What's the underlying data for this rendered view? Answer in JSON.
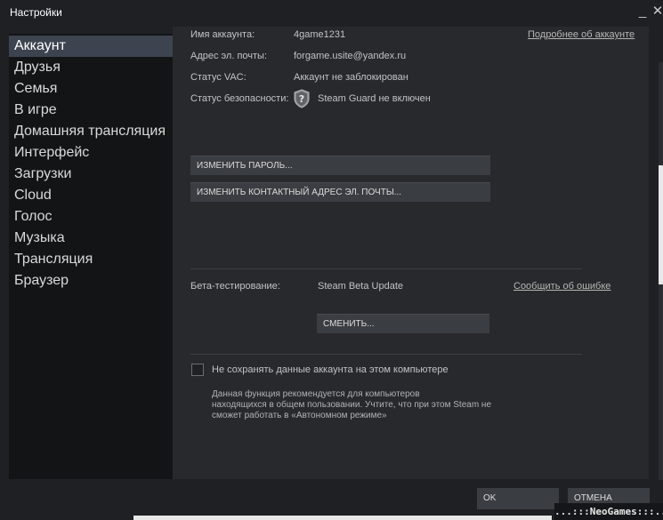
{
  "window": {
    "title": "Настройки",
    "minimize_glyph": "_",
    "close_glyph": "✕"
  },
  "sidebar": {
    "items": [
      {
        "label": "Аккаунт",
        "active": true
      },
      {
        "label": "Друзья"
      },
      {
        "label": "Семья"
      },
      {
        "label": "В игре"
      },
      {
        "label": "Домашняя трансляция"
      },
      {
        "label": "Интерфейс"
      },
      {
        "label": "Загрузки"
      },
      {
        "label": "Cloud"
      },
      {
        "label": "Голос"
      },
      {
        "label": "Музыка"
      },
      {
        "label": "Трансляция"
      },
      {
        "label": "Браузер"
      }
    ]
  },
  "account": {
    "name_label": "Имя аккаунта:",
    "name_value": "4game1231",
    "details_link": "Подробнее об аккаунте",
    "email_label": "Адрес эл. почты:",
    "email_value": "forgame.usite@yandex.ru",
    "vac_label": "Статус VAC:",
    "vac_value": "Аккаунт не заблокирован",
    "security_label": "Статус безопасности:",
    "security_value": "Steam Guard не включен",
    "security_icon": "steam-guard-shield-icon",
    "change_password_button": "ИЗМЕНИТЬ ПАРОЛЬ...",
    "change_email_button": "ИЗМЕНИТЬ КОНТАКТНЫЙ АДРЕС ЭЛ. ПОЧТЫ..."
  },
  "beta": {
    "label": "Бета-тестирование:",
    "value": "Steam Beta Update",
    "report_link": "Сообщить об ошибке",
    "change_button": "СМЕНИТЬ..."
  },
  "remember": {
    "checkbox_label": "Не сохранять данные аккаунта на этом компьютере",
    "checked": false,
    "note_lines": [
      "Данная функция рекомендуется для компьютеров",
      "находящихся в общем пользовании. Учтите, что при этом Steam не",
      "сможет работать в «Автономном режиме»"
    ]
  },
  "footer": {
    "ok_button": "OK",
    "cancel_button": "ОТМЕНА"
  },
  "watermark": "...:::NeoGames:::...",
  "colors": {
    "accent_active": "#3d4450",
    "background": "#1f2024",
    "panel": "#27292d"
  }
}
